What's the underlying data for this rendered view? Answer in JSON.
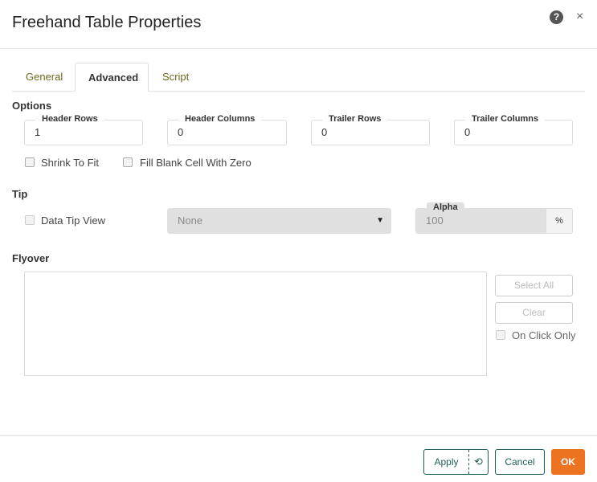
{
  "title": "Freehand Table Properties",
  "help_icon": "?",
  "close_icon": "×",
  "tabs": [
    "General",
    "Advanced",
    "Script"
  ],
  "options": {
    "label": "Options",
    "fields": [
      {
        "label": "Header Rows",
        "value": "1"
      },
      {
        "label": "Header Columns",
        "value": "0"
      },
      {
        "label": "Trailer Rows",
        "value": "0"
      },
      {
        "label": "Trailer Columns",
        "value": "0"
      }
    ],
    "shrink_to_fit": "Shrink To Fit",
    "fill_blank": "Fill Blank Cell With Zero"
  },
  "tip": {
    "label": "Tip",
    "data_tip_view": "Data Tip View",
    "select_value": "None",
    "alpha_label": "Alpha",
    "alpha_value": "100",
    "alpha_unit": "%"
  },
  "flyover": {
    "label": "Flyover",
    "select_all": "Select All",
    "clear": "Clear",
    "on_click_only": "On Click Only"
  },
  "footer": {
    "apply": "Apply",
    "cancel": "Cancel",
    "ok": "OK"
  },
  "colors": {
    "ok": "#ee7320",
    "accent": "#1e5e55"
  }
}
